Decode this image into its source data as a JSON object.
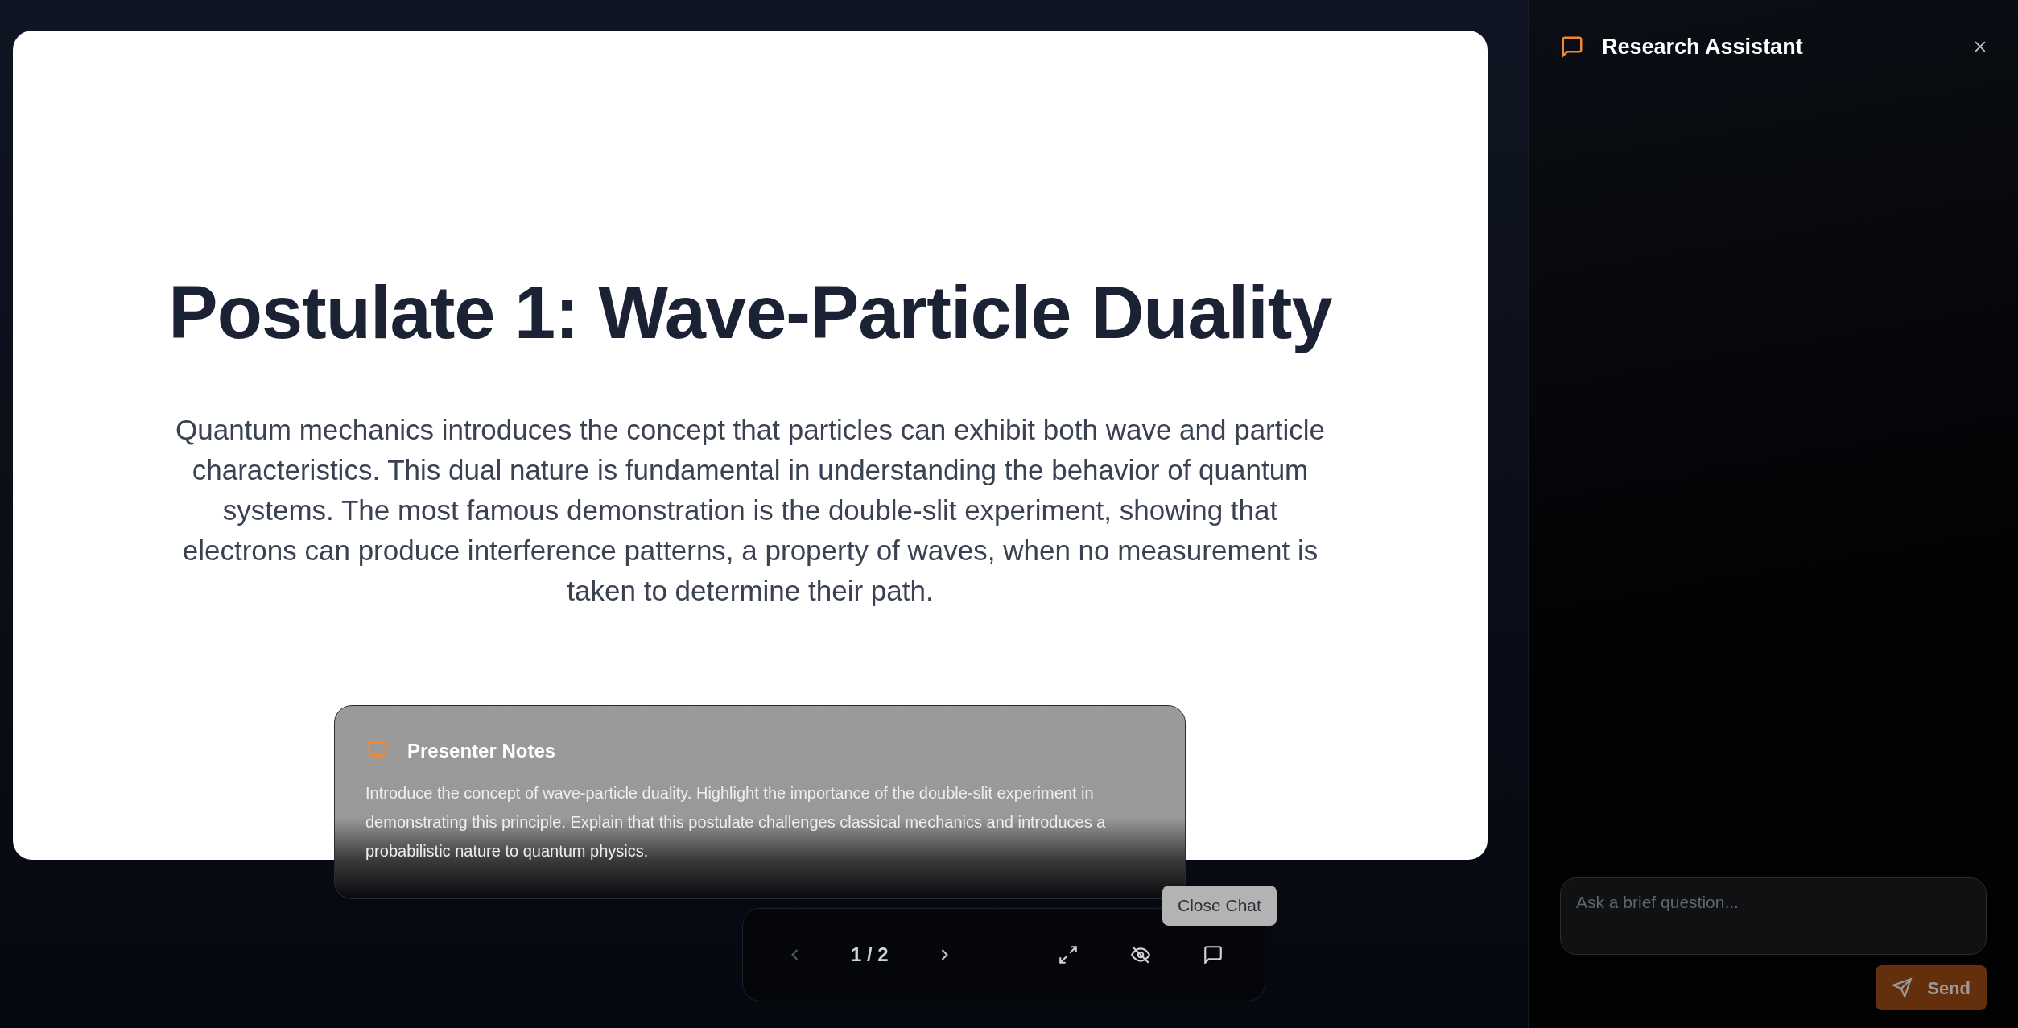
{
  "slide": {
    "title": "Postulate 1: Wave-Particle Duality",
    "body": "Quantum mechanics introduces the concept that particles can exhibit both wave and particle characteristics. This dual nature is fundamental in understanding the behavior of quantum systems. The most famous demonstration is the double-slit experiment, showing that electrons can produce interference patterns, a property of waves, when no measurement is taken to determine their path."
  },
  "presenter_notes": {
    "title": "Presenter Notes",
    "text": "Introduce the concept of wave-particle duality. Highlight the importance of the double-slit experiment in demonstrating this principle. Explain that this postulate challenges classical mechanics and introduces a probabilistic nature to quantum physics."
  },
  "controls": {
    "previous_disabled": true,
    "next_disabled": false,
    "counter": "1 / 2",
    "tooltip": "Close Chat"
  },
  "chat_panel": {
    "title": "Research Assistant",
    "input": {
      "placeholder": "Ask a brief question..."
    },
    "send": {
      "label": "Send",
      "disabled": true
    }
  }
}
